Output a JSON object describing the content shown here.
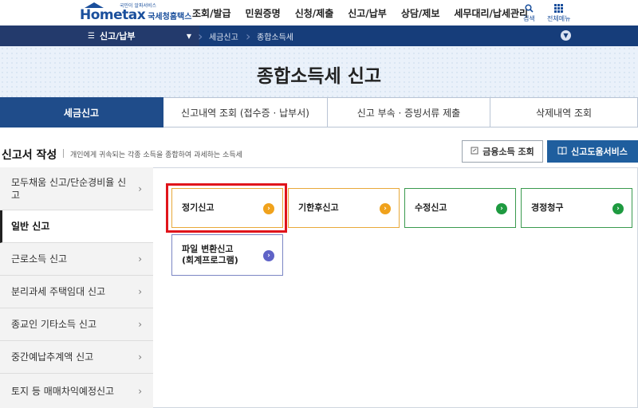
{
  "logo": {
    "main": "Hometax",
    "sub": "국세청홈택스",
    "tag": "국민이 알파서비스"
  },
  "gnb": [
    "조회/발급",
    "민원증명",
    "신청/제출",
    "신고/납부",
    "상담/제보",
    "세무대리/납세관리"
  ],
  "util": {
    "search_label": "검색",
    "menu_label": "전체메뉴"
  },
  "locbar": {
    "menu_label": "신고/납부",
    "crumbs": [
      "세금신고",
      "종합소득세"
    ]
  },
  "banner": {
    "title": "종합소득세 신고"
  },
  "tabs": [
    "세금신고",
    "신고내역 조회 (접수증 · 납부서)",
    "신고 부속 · 증빙서류 제출",
    "삭제내역 조회"
  ],
  "section": {
    "title": "신고서 작성",
    "desc": "개인에게 귀속되는 각종 소득을 종합하여 과세하는 소득세",
    "btn_finance": "금융소득 조회",
    "btn_help": "신고도움서비스"
  },
  "side": [
    "모두채움 신고/단순경비율 신고",
    "일반 신고",
    "근로소득 신고",
    "분리과세 주택임대 신고",
    "종교인 기타소득 신고",
    "중간예납추계액 신고",
    "토지 등 매매차익예정신고"
  ],
  "cards": [
    {
      "label": "정기신고",
      "color": "#f0a21c"
    },
    {
      "label": "기한후신고",
      "color": "#f0a21c"
    },
    {
      "label": "수정신고",
      "color": "#1e9a40"
    },
    {
      "label": "경정청구",
      "color": "#1e9a40"
    },
    {
      "label": "파일 변환신고\n(회계프로그램)",
      "color": "#5f63c7"
    }
  ],
  "colors": {
    "brand": "#1a4f9c",
    "nav": "#163d7a",
    "active_tab": "#1f4c8a",
    "highlight": "#e0141b"
  }
}
